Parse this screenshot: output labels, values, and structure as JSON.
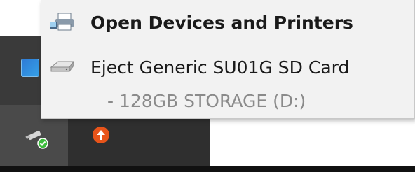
{
  "menu": {
    "items": [
      {
        "label": "Open Devices and Printers",
        "icon": "devices-printers-icon"
      },
      {
        "label": "Eject Generic SU01G SD Card",
        "icon": "drive-icon"
      }
    ],
    "sub_item": {
      "label": "- 128GB STORAGE (D:)"
    }
  },
  "taskbar": {
    "icons": [
      "app-icon",
      "usb-safely-remove-icon",
      "update-arrow-icon"
    ]
  },
  "colors": {
    "menu_bg": "#f2f2f2",
    "taskbar_bg": "#3a3a3a",
    "sub_text": "#8a8a8a",
    "update_badge": "#e8541a",
    "check_badge": "#3cbc3c"
  }
}
